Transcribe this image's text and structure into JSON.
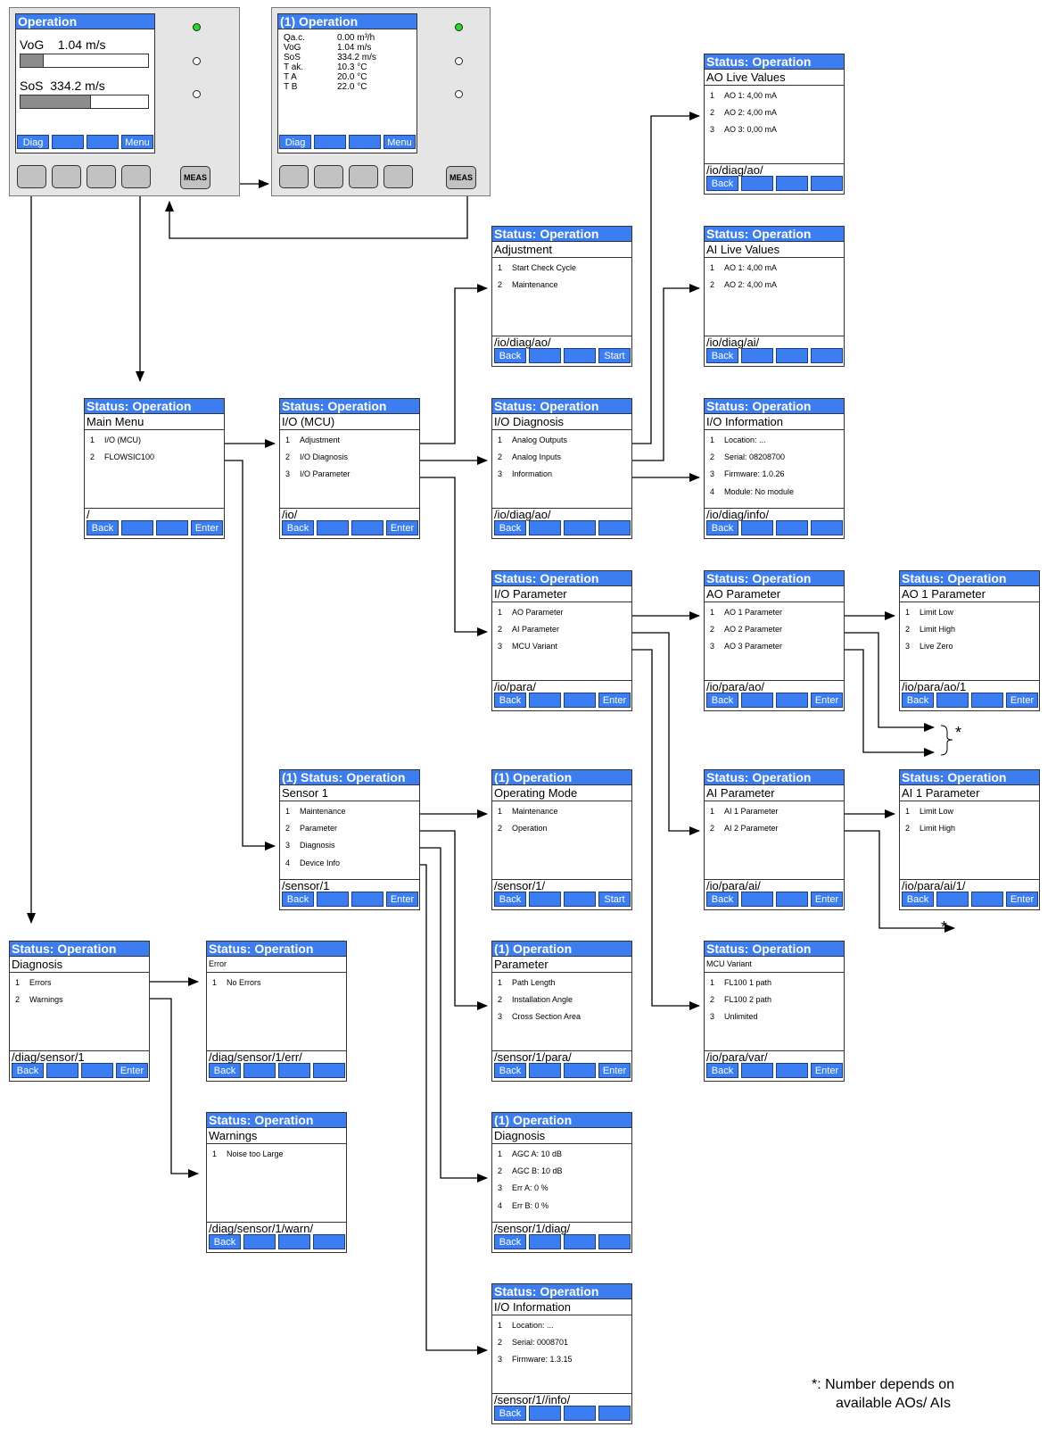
{
  "devices": [
    {
      "id": "dev1",
      "title": "Operation",
      "leds": [
        "on",
        "off",
        "off"
      ],
      "vog_label": "VoG",
      "vog_value": "1.04 m/s",
      "vog_fill": 0.18,
      "sos_label": "SoS",
      "sos_value": "334.2 m/s",
      "sos_fill": 0.55,
      "softkeys": [
        "Diag",
        "",
        "",
        "Menu"
      ],
      "meas_label": "MEAS"
    },
    {
      "id": "dev2",
      "title": "(1) Operation",
      "leds": [
        "on",
        "off",
        "off"
      ],
      "values": [
        {
          "k": "Qa.c.",
          "v": "0.00 m³/h"
        },
        {
          "k": "VoG",
          "v": "1.04 m/s"
        },
        {
          "k": "SoS",
          "v": "334.2 m/s"
        },
        {
          "k": "T ak.",
          "v": "10.3 °C"
        },
        {
          "k": "T A",
          "v": "20.0 °C"
        },
        {
          "k": "T B",
          "v": "22.0 °C"
        }
      ],
      "softkeys": [
        "Diag",
        "",
        "",
        "Menu"
      ],
      "meas_label": "MEAS"
    }
  ],
  "screens": [
    {
      "id": "main",
      "title": "Status: Operation",
      "subtitle": "Main Menu",
      "items": [
        "I/O (MCU)",
        "FLOWSIC100"
      ],
      "path": "/",
      "keys": [
        "Back",
        "",
        "",
        "Enter"
      ]
    },
    {
      "id": "io_mcu",
      "title": "Status: Operation",
      "subtitle": "I/O (MCU)",
      "items": [
        "Adjustment",
        "I/O Diagnosis",
        "I/O Parameter"
      ],
      "path": "/io/",
      "keys": [
        "Back",
        "",
        "",
        "Enter"
      ]
    },
    {
      "id": "adjust",
      "title": "Status: Operation",
      "subtitle": "Adjustment",
      "items": [
        "Start Check Cycle",
        "Maintenance"
      ],
      "path": "/io/diag/ao/",
      "keys": [
        "Back",
        "",
        "",
        "Start"
      ]
    },
    {
      "id": "io_diag",
      "title": "Status: Operation",
      "subtitle": "I/O Diagnosis",
      "items": [
        "Analog Outputs",
        "Analog Inputs",
        "Information"
      ],
      "path": "/io/diag/ao/",
      "keys": [
        "Back",
        "",
        "",
        ""
      ]
    },
    {
      "id": "ao_live",
      "title": "Status: Operation",
      "subtitle": "AO Live Values",
      "items": [
        "AO 1:  4,00 mA",
        "AO 2:  4,00 mA",
        "AO 3:  0,00 mA"
      ],
      "path": "/io/diag/ao/",
      "keys": [
        "Back",
        "",
        "",
        ""
      ]
    },
    {
      "id": "ai_live",
      "title": "Status: Operation",
      "subtitle": "AI Live Values",
      "items": [
        "AO 1:  4,00 mA",
        "AO 2:  4,00 mA"
      ],
      "path": "/io/diag/ai/",
      "keys": [
        "Back",
        "",
        "",
        ""
      ]
    },
    {
      "id": "io_info",
      "title": "Status: Operation",
      "subtitle": "I/O Information",
      "items": [
        "Location: ...",
        "Serial:  08208700",
        "Firmware:   1.0.26",
        "Module:  No module"
      ],
      "path": "/io/diag/info/",
      "keys": [
        "Back",
        "",
        "",
        ""
      ]
    },
    {
      "id": "io_param",
      "title": "Status: Operation",
      "subtitle": "I/O Parameter",
      "items": [
        "AO Parameter",
        "AI Parameter",
        "MCU Variant"
      ],
      "path": "/io/para/",
      "keys": [
        "Back",
        "",
        "",
        "Enter"
      ]
    },
    {
      "id": "ao_param",
      "title": "Status: Operation",
      "subtitle": "AO Parameter",
      "items": [
        "AO 1 Parameter",
        "AO 2 Parameter",
        "AO 3 Parameter"
      ],
      "path": "/io/para/ao/",
      "keys": [
        "Back",
        "",
        "",
        "Enter"
      ]
    },
    {
      "id": "ao1_param",
      "title": "Status: Operation",
      "subtitle": "AO 1 Parameter",
      "items": [
        "Limit Low",
        "Limit High",
        "Live Zero"
      ],
      "path": "/io/para/ao/1",
      "keys": [
        "Back",
        "",
        "",
        "Enter"
      ]
    },
    {
      "id": "sensor1",
      "title": "(1) Status: Operation",
      "subtitle": "Sensor 1",
      "items": [
        "Maintenance",
        "Parameter",
        "Diagnosis",
        "Device Info"
      ],
      "path": "/sensor/1",
      "keys": [
        "Back",
        "",
        "",
        "Enter"
      ]
    },
    {
      "id": "op_mode",
      "title": "(1) Operation",
      "subtitle": "Operating Mode",
      "items": [
        "Maintenance",
        "Operation"
      ],
      "path": "/sensor/1/",
      "keys": [
        "Back",
        "",
        "",
        "Start"
      ]
    },
    {
      "id": "ai_param",
      "title": "Status: Operation",
      "subtitle": "AI Parameter",
      "items": [
        "AI 1 Parameter",
        "AI 2 Parameter"
      ],
      "path": "/io/para/ai/",
      "keys": [
        "Back",
        "",
        "",
        "Enter"
      ]
    },
    {
      "id": "ai1_param",
      "title": "Status: Operation",
      "subtitle": "AI 1 Parameter",
      "items": [
        "Limit Low",
        "Limit High"
      ],
      "path": "/io/para/ai/1/",
      "keys": [
        "Back",
        "",
        "",
        "Enter"
      ]
    },
    {
      "id": "diag",
      "title": "Status: Operation",
      "subtitle": "Diagnosis",
      "items": [
        "Errors",
        "Warnings"
      ],
      "path": "/diag/sensor/1",
      "keys": [
        "Back",
        "",
        "",
        "Enter"
      ]
    },
    {
      "id": "error",
      "title": "Status: Operation",
      "subtitle": "Error",
      "small_sub": true,
      "items": [
        "No Errors"
      ],
      "path": "/diag/sensor/1/err/",
      "keys": [
        "Back",
        "",
        "",
        ""
      ]
    },
    {
      "id": "s1_param",
      "title": "(1) Operation",
      "subtitle": "Parameter",
      "items": [
        "Path Length",
        "Installation Angle",
        "Cross Section Area"
      ],
      "path": "/sensor/1/para/",
      "keys": [
        "Back",
        "",
        "",
        "Enter"
      ]
    },
    {
      "id": "mcu_var",
      "title": "Status: Operation",
      "subtitle": "MCU Variant",
      "small_sub": true,
      "items": [
        "FL100 1 path",
        "FL100 2 path",
        "Unlimited"
      ],
      "path": "/io/para/var/",
      "keys": [
        "Back",
        "",
        "",
        "Enter"
      ]
    },
    {
      "id": "warnings",
      "title": "Status: Operation",
      "subtitle": "Warnings",
      "items": [
        "Noise too Large"
      ],
      "path": "/diag/sensor/1/warn/",
      "keys": [
        "Back",
        "",
        "",
        ""
      ]
    },
    {
      "id": "s1_diag",
      "title": "(1) Operation",
      "subtitle": "Diagnosis",
      "items": [
        "AGC A: 10 dB",
        "AGC B: 10 dB",
        "Err A:      0 %",
        "Err B:      0 %"
      ],
      "path": "/sensor/1/diag/",
      "keys": [
        "Back",
        "",
        "",
        ""
      ]
    },
    {
      "id": "s1_info",
      "title": "Status: Operation",
      "subtitle": "I/O Information",
      "items": [
        "Location: ...",
        "Serial:  0008701",
        "Firmware:   1.3.15"
      ],
      "path": "/sensor/1//info/",
      "keys": [
        "Back",
        "",
        "",
        ""
      ]
    }
  ],
  "markers": {
    "star1": "*",
    "star2": "*"
  },
  "footnote": {
    "line1": "*:  Number depends on",
    "line2": "available AOs/ AIs"
  }
}
